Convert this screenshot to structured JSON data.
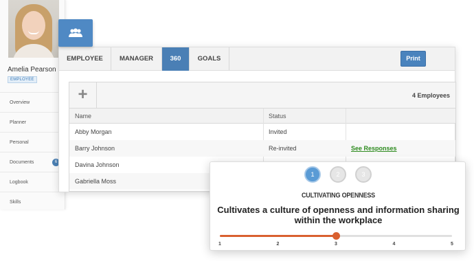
{
  "profile": {
    "name": "Amelia Pearson",
    "role": "EMPLOYEE",
    "nav": [
      {
        "label": "Overview"
      },
      {
        "label": "Planner"
      },
      {
        "label": "Personal"
      },
      {
        "label": "Documents",
        "badge": "6"
      },
      {
        "label": "Logbook"
      },
      {
        "label": "Skills"
      }
    ]
  },
  "group_icon": "people-icon",
  "tabs": [
    {
      "label": "EMPLOYEE",
      "active": false
    },
    {
      "label": "MANAGER",
      "active": false
    },
    {
      "label": "360",
      "active": true
    },
    {
      "label": "GOALS",
      "active": false
    }
  ],
  "print_label": "Print",
  "table": {
    "add_symbol": "+",
    "count_label": "4 Employees",
    "columns": [
      "Name",
      "Status",
      ""
    ],
    "rows": [
      {
        "name": "Abby Morgan",
        "status": "Invited",
        "action": ""
      },
      {
        "name": "Barry Johnson",
        "status": "Re-invited",
        "action": "See Responses"
      },
      {
        "name": "Davina Johnson",
        "status": "",
        "action": ""
      },
      {
        "name": "Gabriella Moss",
        "status": "",
        "action": ""
      }
    ]
  },
  "rating": {
    "steps": [
      "1",
      "2",
      "3"
    ],
    "active_step": 1,
    "competency": "CULTIVATING OPENNESS",
    "statement_line1": "Cultivates a culture of openness and information sharing",
    "statement_line2": "within the workplace",
    "scale": [
      "1",
      "2",
      "3",
      "4",
      "5"
    ],
    "value": 3,
    "accent_color": "#d9602f"
  },
  "colors": {
    "tab_active": "#4a7fb5",
    "link": "#2e8b1f"
  }
}
